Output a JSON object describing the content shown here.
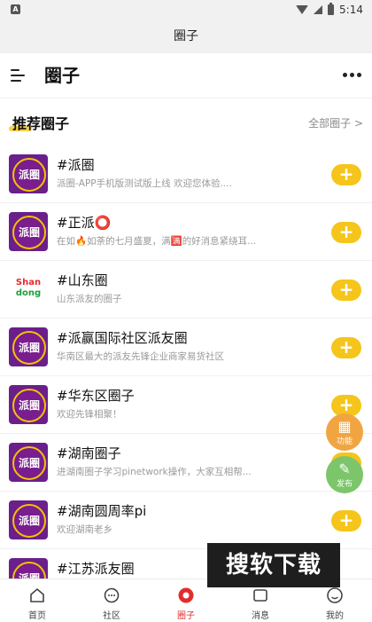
{
  "status_bar": {
    "left_icon": "A",
    "time": "5:14"
  },
  "window": {
    "title": "圈子"
  },
  "header": {
    "title": "圈子",
    "menu_icon": "menu-icon",
    "more_icon": "more-icon"
  },
  "section": {
    "title": "推荐圈子",
    "all_link": "全部圈子 >"
  },
  "circles": [
    {
      "name": "#派圈",
      "desc": "派圈-APP手机版测试版上线 欢迎您体验....",
      "avatar": "派圈",
      "action": "+"
    },
    {
      "name": "#正派⭕",
      "desc": "在如🔥如荼的七月盛夏，满🈵的好消息紧绕耳...",
      "avatar": "派圈",
      "action": "+"
    },
    {
      "name": "#山东圈",
      "desc": "山东派友的圈子",
      "avatar": "Shan dong",
      "action": "+"
    },
    {
      "name": "#派赢国际社区派友圈",
      "desc": "华南区最大的派友先锋企业商家易货社区",
      "avatar": "派圈",
      "action": "+"
    },
    {
      "name": "#华东区圈子",
      "desc": "欢迎先锋相聚！",
      "avatar": "派圈",
      "action": "+"
    },
    {
      "name": "#湖南圈子",
      "desc": "进湖南圈子学习pinetwork操作，大家互相帮...",
      "avatar": "派圈",
      "action": "+"
    },
    {
      "name": "#湖南圆周率pi",
      "desc": "欢迎湖南老乡",
      "avatar": "派圈",
      "action": "+"
    },
    {
      "name": "#江苏派友圈",
      "desc": "",
      "avatar": "派圈",
      "action": "+"
    }
  ],
  "fabs": {
    "function_label": "功能",
    "post_label": "发布"
  },
  "watermark": "搜软下载",
  "bottom_nav": [
    {
      "label": "首页",
      "icon": "home-icon"
    },
    {
      "label": "社区",
      "icon": "chat-icon"
    },
    {
      "label": "圈子",
      "icon": "circle-icon"
    },
    {
      "label": "消息",
      "icon": "message-icon"
    },
    {
      "label": "我的",
      "icon": "profile-icon"
    }
  ],
  "colors": {
    "accent": "#f5c51b",
    "avatar_purple": "#6a1f8a",
    "active_nav": "#e12d2d"
  }
}
